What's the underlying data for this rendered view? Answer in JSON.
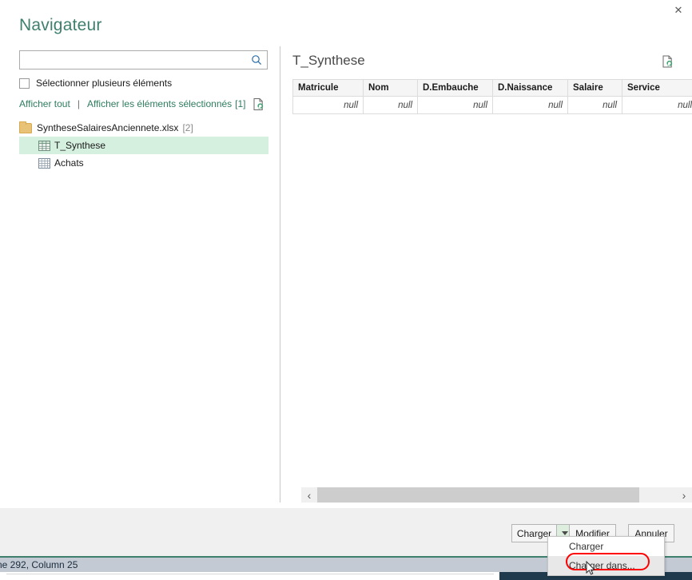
{
  "window": {
    "title": "Navigateur",
    "close_label": "✕",
    "close_icon": "close-icon"
  },
  "search": {
    "value": "",
    "placeholder": "",
    "icon": "search-icon"
  },
  "options": {
    "multi_select_label": "Sélectionner plusieurs éléments",
    "multi_select_checked": false,
    "show_all_label": "Afficher tout",
    "separator": "|",
    "show_selected_label": "Afficher les éléments sélectionnés",
    "selected_count": "[1]",
    "refresh_icon": "refresh-document-icon"
  },
  "tree": {
    "root": {
      "label": "SyntheseSalairesAnciennete.xlsx",
      "count": "[2]",
      "icon": "folder-icon",
      "expanded": true
    },
    "children": [
      {
        "label": "T_Synthese",
        "icon": "table-grid-icon",
        "selected": true
      },
      {
        "label": "Achats",
        "icon": "worksheet-grid-icon",
        "selected": false
      }
    ]
  },
  "preview": {
    "title": "T_Synthese",
    "refresh_icon": "refresh-document-icon",
    "columns": [
      "Matricule",
      "Nom",
      "D.Embauche",
      "D.Naissance",
      "Salaire",
      "Service"
    ],
    "rows": [
      [
        "null",
        "null",
        "null",
        "null",
        "null",
        "null"
      ]
    ]
  },
  "scrollbar": {
    "left_arrow": "‹",
    "right_arrow": "›",
    "left_arrow_icon": "chevron-left-icon",
    "right_arrow_icon": "chevron-right-icon"
  },
  "footer": {
    "load_label": "Charger",
    "load_dropdown_icon": "chevron-down-icon",
    "edit_label": "Modifier",
    "cancel_label": "Annuler"
  },
  "dropdown_menu": {
    "items": [
      {
        "label": "Charger",
        "highlighted": false
      },
      {
        "label": "Charger dans...",
        "highlighted": true
      }
    ]
  },
  "status": {
    "text": "ne 292, Column 25"
  },
  "colors": {
    "title": "#3f7f6d",
    "link": "#2e7d5f",
    "selection": "#d6f0e0",
    "accent_line": "#3f7f6d",
    "highlight_ring": "#ff0000",
    "status_bar": "#c3cad4",
    "taskbar": "#1e3a4c"
  }
}
